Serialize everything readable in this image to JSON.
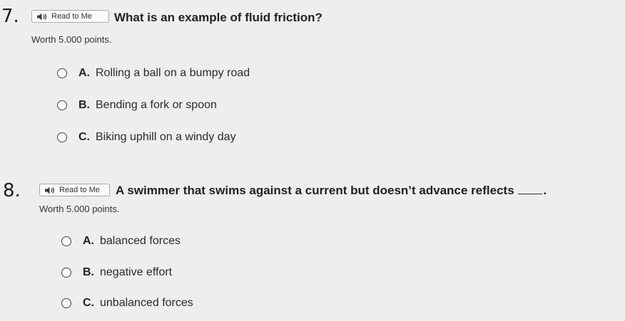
{
  "questions": [
    {
      "number": "7.",
      "read_label": "Read to Me",
      "text": "What is an example of fluid friction?",
      "points": "Worth 5.000 points.",
      "choices": [
        {
          "letter": "A.",
          "text": "Rolling a ball on a bumpy road"
        },
        {
          "letter": "B.",
          "text": "Bending a fork or spoon"
        },
        {
          "letter": "C.",
          "text": "Biking uphill on a windy day"
        }
      ]
    },
    {
      "number": "8.",
      "read_label": "Read to Me",
      "text_before": "A swimmer that swims against a current but doesn’t advance reflects",
      "text_after": ".",
      "points": "Worth 5.000 points.",
      "choices": [
        {
          "letter": "A.",
          "text": "balanced forces"
        },
        {
          "letter": "B.",
          "text": "negative effort"
        },
        {
          "letter": "C.",
          "text": "unbalanced forces"
        }
      ]
    }
  ],
  "icons": {
    "speaker": "speaker-icon",
    "radio": "radio-icon"
  }
}
